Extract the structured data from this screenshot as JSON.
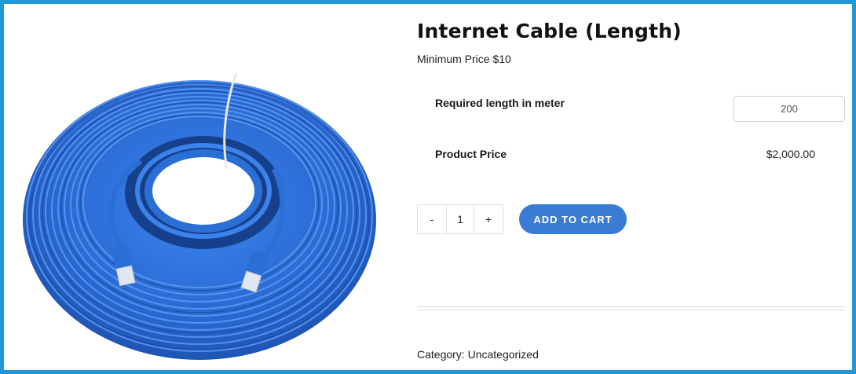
{
  "product": {
    "title": "Internet Cable (Length)",
    "minimum_price": "Minimum Price $10",
    "image_alt": "Blue ethernet cable coil"
  },
  "options": {
    "length_label": "Required length in meter",
    "length_value": "200",
    "price_label": "Product Price",
    "price_value": "$2,000.00"
  },
  "cart": {
    "minus": "-",
    "quantity": "1",
    "plus": "+",
    "add_label": "ADD TO CART"
  },
  "meta": {
    "category_label": "Category:",
    "category_value": "Uncategorized"
  },
  "colors": {
    "frame": "#1f98d8",
    "cable": "#2a6fd6",
    "button": "#3a7bd5"
  }
}
